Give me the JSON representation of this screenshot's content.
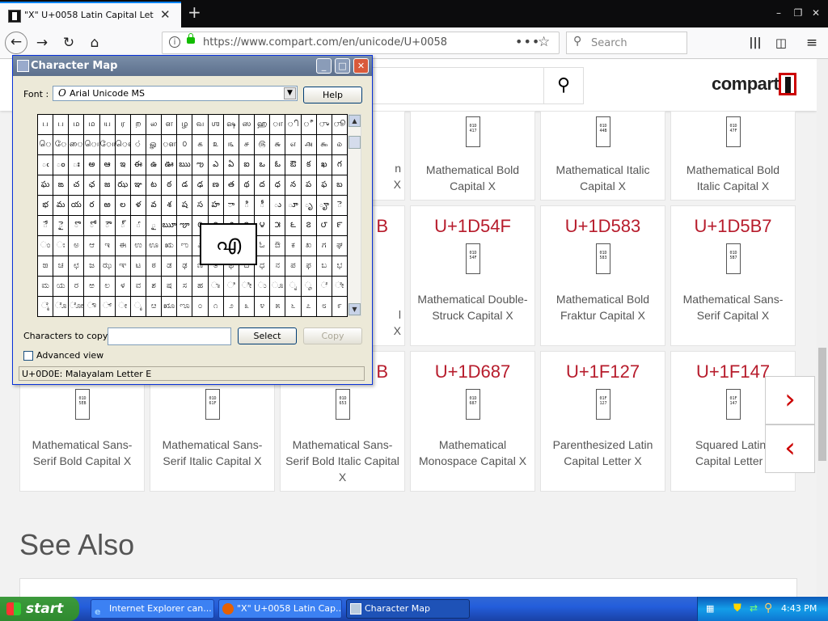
{
  "browser": {
    "tab_title": "\"X\" U+0058 Latin Capital Letter X",
    "tab_close": "✕",
    "new_tab": "+",
    "window_controls": {
      "minimize": "–",
      "restore": "❐",
      "close": "✕"
    },
    "url": "https://www.compart.com/en/unicode/U+0058",
    "page_actions": "•••",
    "bookmark": "☆",
    "search_placeholder": "Search",
    "toolbar_icons": [
      "library-icon",
      "sidebar-icon",
      "menu-icon"
    ]
  },
  "site": {
    "logo": "compart",
    "cards_row1": [
      {
        "name": "n\nX"
      },
      {
        "name": "Mathematical Bold Capital X",
        "glyph": "01D\n417"
      },
      {
        "name": "Mathematical Italic Capital X",
        "glyph": "01D\n44B"
      },
      {
        "name": "Mathematical Bold Italic Capital X",
        "glyph": "01D\n47F"
      }
    ],
    "cards_row2": [
      {
        "code": "B",
        "name": "l\nX"
      },
      {
        "code": "U+1D54F",
        "name": "Mathematical Double-Struck Capital X",
        "glyph": "01D\n54F"
      },
      {
        "code": "U+1D583",
        "name": "Mathematical Bold Fraktur Capital X",
        "glyph": "01D\n583"
      },
      {
        "code": "U+1D5B7",
        "name": "Mathematical Sans-Serif Capital X",
        "glyph": "01D\n5B7"
      }
    ],
    "cards_row3": [
      {
        "name": "Mathematical Sans-Serif Bold Capital X",
        "glyph": "01D\n5EB"
      },
      {
        "name": "Mathematical Sans-Serif Italic Capital X",
        "glyph": "01D\n61F"
      },
      {
        "code": "B",
        "name": "Mathematical Sans-Serif Bold Italic Capital X",
        "glyph": "01D\n653"
      },
      {
        "code": "U+1D687",
        "name": "Mathematical Monospace Capital X",
        "glyph": "01D\n687"
      },
      {
        "code": "U+1F127",
        "name": "Parenthesized Latin Capital Letter X",
        "glyph": "01F\n127"
      },
      {
        "code": "U+1F147",
        "name": "Squared Latin Capital Letter X",
        "glyph": "01F\n147"
      }
    ],
    "see_also": "See Also",
    "next_arrow": "›",
    "prev_arrow": "‹"
  },
  "charmap": {
    "title": "Character Map",
    "font_label": "Font :",
    "font_value": "Arial Unicode MS",
    "help": "Help",
    "chars_label": "Characters to copy :",
    "chars_value": "",
    "select": "Select",
    "copy": "Copy",
    "advanced": "Advanced view",
    "status": "U+0D0E: Malayalam Letter E",
    "zoom_char": "എ",
    "grid": [
      "ப",
      "ப",
      "ம",
      "ம",
      "ய",
      "ர",
      "ற",
      "ல",
      "ள",
      "ழ",
      "வ",
      "ஶ",
      "ஷ",
      "ஸ",
      "ஹ",
      "ா",
      "ி",
      "ீ",
      "ு",
      "ூ",
      "ெ",
      "ே",
      "ை",
      "ொ",
      "ோ",
      "ௌ",
      "்",
      "ௐ",
      "ௗ",
      "௦",
      "௧",
      "௨",
      "௩",
      "௪",
      "௫",
      "௬",
      "௭",
      "௮",
      "௯",
      "௰",
      "ఁ",
      "ం",
      "ః",
      "అ",
      "ఆ",
      "ఇ",
      "ఈ",
      "ఉ",
      "ఊ",
      "ఋ",
      "ఌ",
      "ఎ",
      "ఏ",
      "ఐ",
      "ఒ",
      "ఓ",
      "ఔ",
      "క",
      "ఖ",
      "గ",
      "ఘ",
      "ఙ",
      "చ",
      "ఛ",
      "జ",
      "ఝ",
      "ఞ",
      "ట",
      "ఠ",
      "డ",
      "ఢ",
      "ణ",
      "త",
      "థ",
      "ద",
      "ధ",
      "న",
      "ప",
      "ఫ",
      "బ",
      "భ",
      "మ",
      "య",
      "ర",
      "ఱ",
      "ల",
      "ళ",
      "వ",
      "శ",
      "ష",
      "స",
      "హ",
      "ా",
      "ి",
      "ీ",
      "ు",
      "ూ",
      "ృ",
      "ౄ",
      "ె",
      "ే",
      "ై",
      "ొ",
      "ో",
      "ౌ",
      "్",
      "ౕ",
      "ౖ",
      "ౠ",
      "ౡ",
      "౦",
      "౧",
      "౨",
      "౩",
      "౪",
      "౫",
      "౬",
      "౭",
      "౮",
      "౯",
      "ಂ",
      "ಃ",
      "ಅ",
      "ಆ",
      "ಇ",
      "ಈ",
      "ಉ",
      "ಊ",
      "ಋ",
      "ಌ",
      "ಎ",
      "ಏ",
      "ಐ",
      "ಒ",
      "ಓ",
      "ಔ",
      "ಕ",
      "ಖ",
      "ಗ",
      "ಘ",
      "ಙ",
      "ಚ",
      "ಛ",
      "ಜ",
      "ಝ",
      "ಞ",
      "ಟ",
      "ಠ",
      "ಡ",
      "ಢ",
      "ಣ",
      "ತ",
      "ಥ",
      "ದ",
      "ಧ",
      "ನ",
      "ಪ",
      "ಫ",
      "ಬ",
      "ಭ",
      "ಮ",
      "ಯ",
      "ರ",
      "ಱ",
      "ಲ",
      "ಳ",
      "ವ",
      "ಶ",
      "ಷ",
      "ಸ",
      "ಹ",
      "ಾ",
      "ಿ",
      "ೀ",
      "ು",
      "ೂ",
      "ೃ",
      "ೄ",
      "ೆ",
      "ೇ",
      "ೈ",
      "ೊ",
      "ೋ",
      "ೌ",
      "್",
      "ೕ",
      "ೖ",
      "ೞ",
      "ೠ",
      "ೡ",
      "೦",
      "೧",
      "೨",
      "೩",
      "೪",
      "೫",
      "೬",
      "೭",
      "೮",
      "೯"
    ]
  },
  "taskbar": {
    "start": "start",
    "items": [
      "Internet Explorer can...",
      "\"X\" U+0058 Latin Cap...",
      "Character Map"
    ],
    "clock": "4:43 PM"
  }
}
